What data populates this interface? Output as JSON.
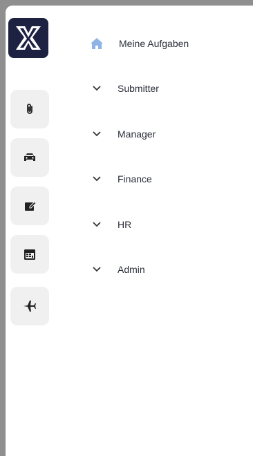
{
  "app": {
    "logo_text": "YX"
  },
  "rail": {
    "items": [
      {
        "icon": "paperclip-icon"
      },
      {
        "icon": "car-icon"
      },
      {
        "icon": "edit-note-icon"
      },
      {
        "icon": "calendar-icon"
      },
      {
        "icon": "airplane-icon"
      }
    ]
  },
  "nav": {
    "home_label": "Meine Aufgaben",
    "sections": [
      {
        "label": "Submitter"
      },
      {
        "label": "Manager"
      },
      {
        "label": "Finance"
      },
      {
        "label": "HR"
      },
      {
        "label": "Admin"
      }
    ]
  },
  "colors": {
    "logo_bg": "#1d2142",
    "home_icon": "#8fb3e6",
    "rail_btn_bg": "#f0f0f0",
    "text": "#2b2f3a"
  }
}
